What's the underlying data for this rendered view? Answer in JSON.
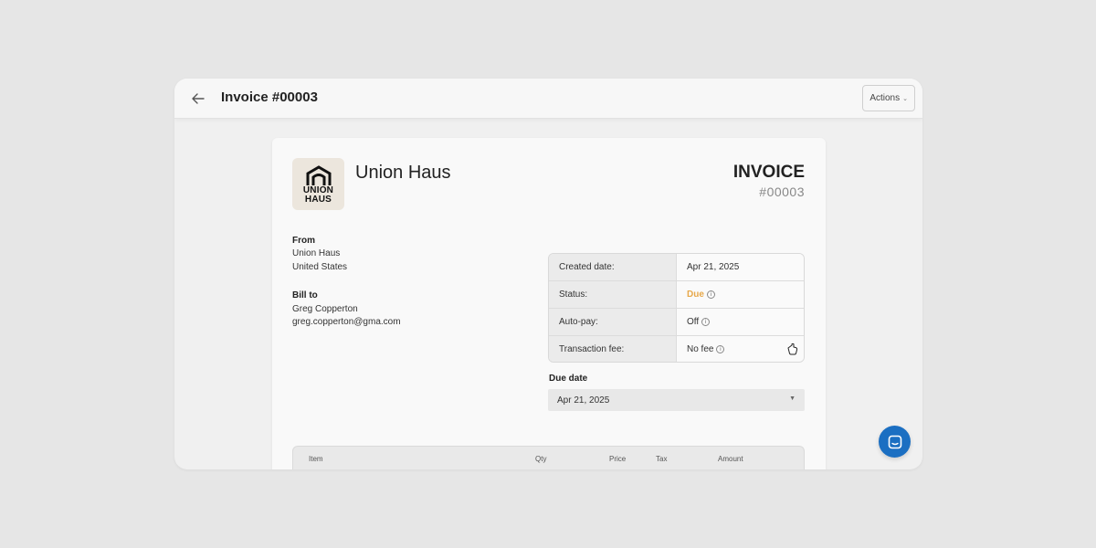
{
  "header": {
    "title": "Invoice #00003",
    "actions_label": "Actions"
  },
  "invoice": {
    "logo_text_line1": "UNION",
    "logo_text_line2": "HAUS",
    "company_name": "Union Haus",
    "heading": "INVOICE",
    "number": "#00003"
  },
  "from": {
    "label": "From",
    "name": "Union Haus",
    "country": "United States"
  },
  "bill_to": {
    "label": "Bill to",
    "name": "Greg Copperton",
    "email": "greg.copperton@gma.com"
  },
  "meta": {
    "created_label": "Created date:",
    "created_value": "Apr 21, 2025",
    "status_label": "Status:",
    "status_value": "Due",
    "autopay_label": "Auto-pay:",
    "autopay_value": "Off",
    "fee_label": "Transaction fee:",
    "fee_value": "No fee"
  },
  "due_date": {
    "label": "Due date",
    "value": "Apr 21, 2025"
  },
  "items_table": {
    "columns": [
      "Item",
      "Qty",
      "Price",
      "Tax",
      "Amount"
    ]
  },
  "colors": {
    "status_due": "#e7a84a",
    "chat_button": "#1b6fc2"
  },
  "icons": [
    "arrow-left-icon",
    "chevron-down-icon",
    "info-icon",
    "pointer-cursor-icon",
    "chat-icon"
  ]
}
